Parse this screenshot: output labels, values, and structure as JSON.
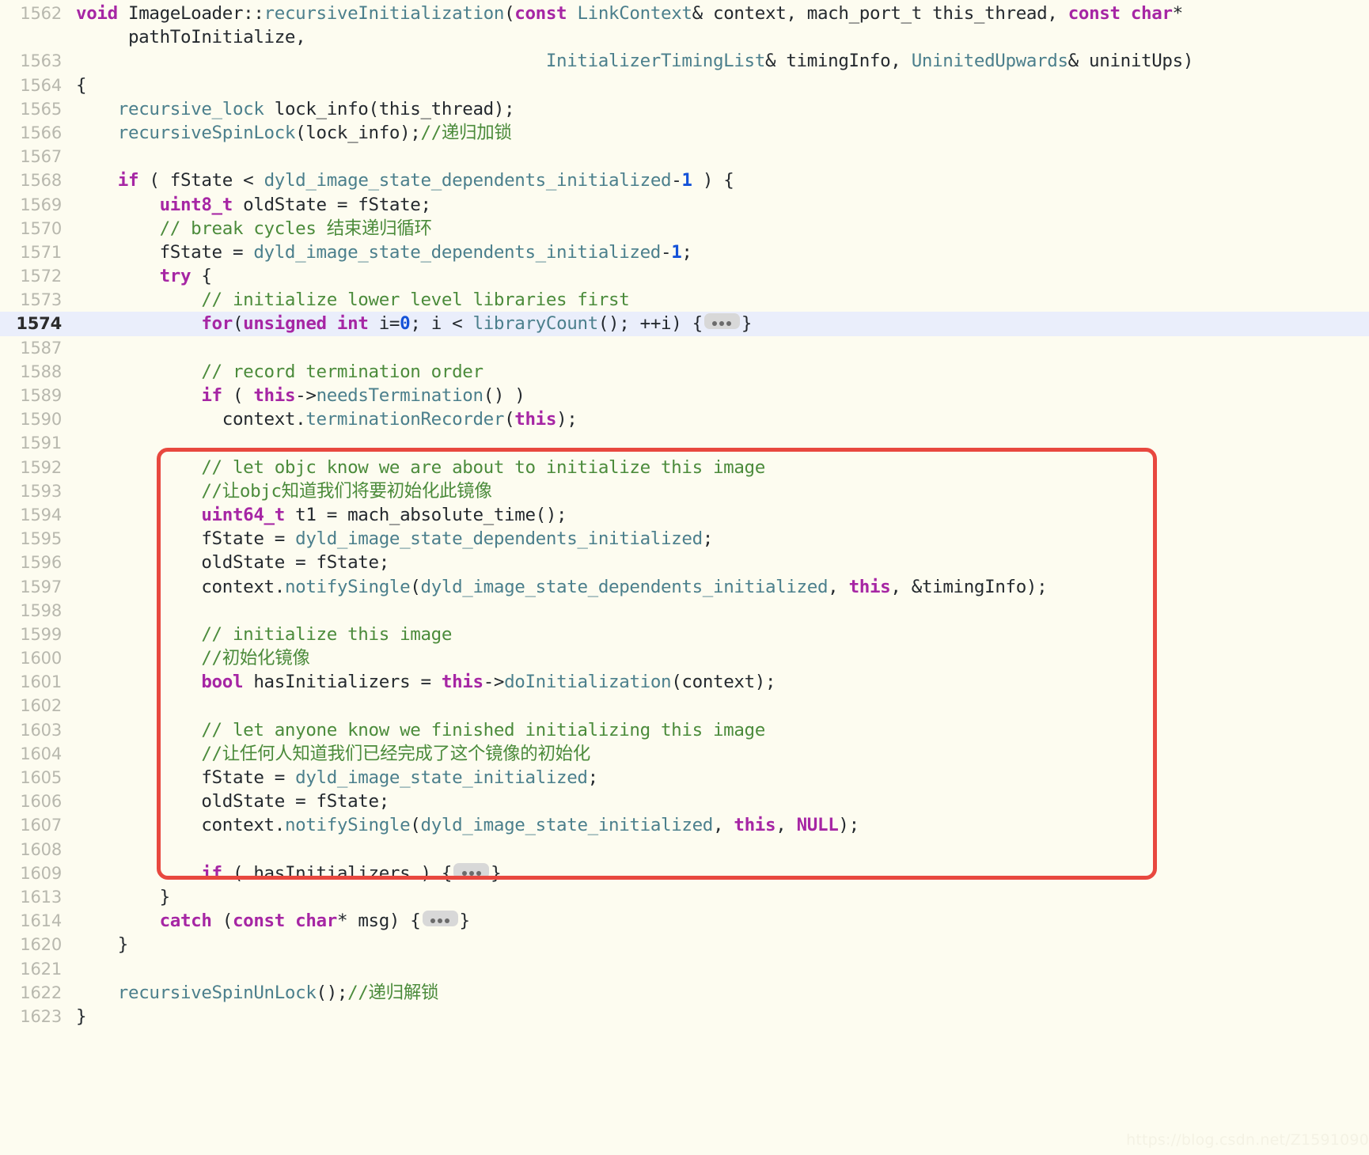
{
  "viewer": {
    "language": "C++",
    "background_color": "#fdfcf0",
    "highlight_color": "#eaeefb",
    "annotation_color": "#e8483f",
    "gutter_color": "#b8b8ae"
  },
  "watermark": {
    "text": "https://blog.csdn.net/Z1591090"
  },
  "collapse_button": {
    "label": "•••",
    "name": "expand-hidden-lines"
  },
  "annotation": {
    "type": "red-rounded-rectangle",
    "covers_lines": "1592-1607",
    "color": "#e8483f"
  },
  "lines": [
    {
      "num": "1562",
      "highlight": false,
      "tokens": [
        {
          "t": "kw",
          "s": "void"
        },
        {
          "t": "plain",
          "s": " ImageLoader::"
        },
        {
          "t": "typ",
          "s": "recursiveInitialization"
        },
        {
          "t": "plain",
          "s": "("
        },
        {
          "t": "kw",
          "s": "const"
        },
        {
          "t": "plain",
          "s": " "
        },
        {
          "t": "typ",
          "s": "LinkContext"
        },
        {
          "t": "plain",
          "s": "& context, mach_port_t this_thread, "
        },
        {
          "t": "kw",
          "s": "const char"
        },
        {
          "t": "plain",
          "s": "*"
        }
      ]
    },
    {
      "num": "",
      "highlight": false,
      "indent": 0,
      "tokens": [
        {
          "t": "plain",
          "s": "     pathToInitialize,"
        }
      ]
    },
    {
      "num": "1563",
      "highlight": false,
      "tokens": [
        {
          "t": "plain",
          "s": "                                             "
        },
        {
          "t": "typ",
          "s": "InitializerTimingList"
        },
        {
          "t": "plain",
          "s": "& timingInfo, "
        },
        {
          "t": "typ",
          "s": "UninitedUpwards"
        },
        {
          "t": "plain",
          "s": "& uninitUps)"
        }
      ]
    },
    {
      "num": "1564",
      "highlight": false,
      "tokens": [
        {
          "t": "plain",
          "s": "{"
        }
      ]
    },
    {
      "num": "1565",
      "highlight": false,
      "tokens": [
        {
          "t": "plain",
          "s": "    "
        },
        {
          "t": "typ",
          "s": "recursive_lock"
        },
        {
          "t": "plain",
          "s": " lock_info(this_thread);"
        }
      ]
    },
    {
      "num": "1566",
      "highlight": false,
      "tokens": [
        {
          "t": "plain",
          "s": "    "
        },
        {
          "t": "typ",
          "s": "recursiveSpinLock"
        },
        {
          "t": "plain",
          "s": "(lock_info);"
        },
        {
          "t": "cmt",
          "s": "//递归加锁"
        }
      ]
    },
    {
      "num": "1567",
      "highlight": false,
      "tokens": []
    },
    {
      "num": "1568",
      "highlight": false,
      "tokens": [
        {
          "t": "plain",
          "s": "    "
        },
        {
          "t": "kw",
          "s": "if"
        },
        {
          "t": "plain",
          "s": " ( fState < "
        },
        {
          "t": "typ",
          "s": "dyld_image_state_dependents_initialized"
        },
        {
          "t": "plain",
          "s": "-"
        },
        {
          "t": "num",
          "s": "1"
        },
        {
          "t": "plain",
          "s": " ) {"
        }
      ]
    },
    {
      "num": "1569",
      "highlight": false,
      "tokens": [
        {
          "t": "plain",
          "s": "        "
        },
        {
          "t": "kw",
          "s": "uint8_t"
        },
        {
          "t": "plain",
          "s": " oldState = fState;"
        }
      ]
    },
    {
      "num": "1570",
      "highlight": false,
      "tokens": [
        {
          "t": "plain",
          "s": "        "
        },
        {
          "t": "cmt",
          "s": "// break cycles 结束递归循环"
        }
      ]
    },
    {
      "num": "1571",
      "highlight": false,
      "tokens": [
        {
          "t": "plain",
          "s": "        fState = "
        },
        {
          "t": "typ",
          "s": "dyld_image_state_dependents_initialized"
        },
        {
          "t": "plain",
          "s": "-"
        },
        {
          "t": "num",
          "s": "1"
        },
        {
          "t": "plain",
          "s": ";"
        }
      ]
    },
    {
      "num": "1572",
      "highlight": false,
      "tokens": [
        {
          "t": "plain",
          "s": "        "
        },
        {
          "t": "kw",
          "s": "try"
        },
        {
          "t": "plain",
          "s": " {"
        }
      ]
    },
    {
      "num": "1573",
      "highlight": false,
      "tokens": [
        {
          "t": "plain",
          "s": "            "
        },
        {
          "t": "cmt",
          "s": "// initialize lower level libraries first"
        }
      ]
    },
    {
      "num": "1574",
      "highlight": true,
      "tokens": [
        {
          "t": "plain",
          "s": "            "
        },
        {
          "t": "kw",
          "s": "for"
        },
        {
          "t": "plain",
          "s": "("
        },
        {
          "t": "kw",
          "s": "unsigned int"
        },
        {
          "t": "plain",
          "s": " i="
        },
        {
          "t": "num",
          "s": "0"
        },
        {
          "t": "plain",
          "s": "; i < "
        },
        {
          "t": "fn",
          "s": "libraryCount"
        },
        {
          "t": "plain",
          "s": "(); ++i) {"
        },
        {
          "t": "dots",
          "s": "•••"
        },
        {
          "t": "plain",
          "s": "}"
        }
      ]
    },
    {
      "num": "1587",
      "highlight": false,
      "tokens": []
    },
    {
      "num": "1588",
      "highlight": false,
      "tokens": [
        {
          "t": "plain",
          "s": "            "
        },
        {
          "t": "cmt",
          "s": "// record termination order"
        }
      ]
    },
    {
      "num": "1589",
      "highlight": false,
      "tokens": [
        {
          "t": "plain",
          "s": "            "
        },
        {
          "t": "kw",
          "s": "if"
        },
        {
          "t": "plain",
          "s": " ( "
        },
        {
          "t": "kw",
          "s": "this"
        },
        {
          "t": "plain",
          "s": "->"
        },
        {
          "t": "fn",
          "s": "needsTermination"
        },
        {
          "t": "plain",
          "s": "() )"
        }
      ]
    },
    {
      "num": "1590",
      "highlight": false,
      "tokens": [
        {
          "t": "plain",
          "s": "              context."
        },
        {
          "t": "fn",
          "s": "terminationRecorder"
        },
        {
          "t": "plain",
          "s": "("
        },
        {
          "t": "kw",
          "s": "this"
        },
        {
          "t": "plain",
          "s": ");"
        }
      ]
    },
    {
      "num": "1591",
      "highlight": false,
      "tokens": []
    },
    {
      "num": "1592",
      "highlight": false,
      "tokens": [
        {
          "t": "plain",
          "s": "            "
        },
        {
          "t": "cmt",
          "s": "// let objc know we are about to initialize this image"
        }
      ]
    },
    {
      "num": "1593",
      "highlight": false,
      "tokens": [
        {
          "t": "plain",
          "s": "            "
        },
        {
          "t": "cmt",
          "s": "//让objc知道我们将要初始化此镜像"
        }
      ]
    },
    {
      "num": "1594",
      "highlight": false,
      "tokens": [
        {
          "t": "plain",
          "s": "            "
        },
        {
          "t": "kw",
          "s": "uint64_t"
        },
        {
          "t": "plain",
          "s": " t1 = mach_absolute_time();"
        }
      ]
    },
    {
      "num": "1595",
      "highlight": false,
      "tokens": [
        {
          "t": "plain",
          "s": "            fState = "
        },
        {
          "t": "typ",
          "s": "dyld_image_state_dependents_initialized"
        },
        {
          "t": "plain",
          "s": ";"
        }
      ]
    },
    {
      "num": "1596",
      "highlight": false,
      "tokens": [
        {
          "t": "plain",
          "s": "            oldState = fState;"
        }
      ]
    },
    {
      "num": "1597",
      "highlight": false,
      "tokens": [
        {
          "t": "plain",
          "s": "            context."
        },
        {
          "t": "fn",
          "s": "notifySingle"
        },
        {
          "t": "plain",
          "s": "("
        },
        {
          "t": "typ",
          "s": "dyld_image_state_dependents_initialized"
        },
        {
          "t": "plain",
          "s": ", "
        },
        {
          "t": "kw",
          "s": "this"
        },
        {
          "t": "plain",
          "s": ", &timingInfo);"
        }
      ]
    },
    {
      "num": "1598",
      "highlight": false,
      "tokens": []
    },
    {
      "num": "1599",
      "highlight": false,
      "tokens": [
        {
          "t": "plain",
          "s": "            "
        },
        {
          "t": "cmt",
          "s": "// initialize this image"
        }
      ]
    },
    {
      "num": "1600",
      "highlight": false,
      "tokens": [
        {
          "t": "plain",
          "s": "            "
        },
        {
          "t": "cmt",
          "s": "//初始化镜像"
        }
      ]
    },
    {
      "num": "1601",
      "highlight": false,
      "tokens": [
        {
          "t": "plain",
          "s": "            "
        },
        {
          "t": "kw",
          "s": "bool"
        },
        {
          "t": "plain",
          "s": " hasInitializers = "
        },
        {
          "t": "kw",
          "s": "this"
        },
        {
          "t": "plain",
          "s": "->"
        },
        {
          "t": "fn",
          "s": "doInitialization"
        },
        {
          "t": "plain",
          "s": "(context);"
        }
      ]
    },
    {
      "num": "1602",
      "highlight": false,
      "tokens": []
    },
    {
      "num": "1603",
      "highlight": false,
      "tokens": [
        {
          "t": "plain",
          "s": "            "
        },
        {
          "t": "cmt",
          "s": "// let anyone know we finished initializing this image"
        }
      ]
    },
    {
      "num": "1604",
      "highlight": false,
      "tokens": [
        {
          "t": "plain",
          "s": "            "
        },
        {
          "t": "cmt",
          "s": "//让任何人知道我们已经完成了这个镜像的初始化"
        }
      ]
    },
    {
      "num": "1605",
      "highlight": false,
      "tokens": [
        {
          "t": "plain",
          "s": "            fState = "
        },
        {
          "t": "typ",
          "s": "dyld_image_state_initialized"
        },
        {
          "t": "plain",
          "s": ";"
        }
      ]
    },
    {
      "num": "1606",
      "highlight": false,
      "tokens": [
        {
          "t": "plain",
          "s": "            oldState = fState;"
        }
      ]
    },
    {
      "num": "1607",
      "highlight": false,
      "tokens": [
        {
          "t": "plain",
          "s": "            context."
        },
        {
          "t": "fn",
          "s": "notifySingle"
        },
        {
          "t": "plain",
          "s": "("
        },
        {
          "t": "typ",
          "s": "dyld_image_state_initialized"
        },
        {
          "t": "plain",
          "s": ", "
        },
        {
          "t": "kw",
          "s": "this"
        },
        {
          "t": "plain",
          "s": ", "
        },
        {
          "t": "kw",
          "s": "NULL"
        },
        {
          "t": "plain",
          "s": ");"
        }
      ]
    },
    {
      "num": "1608",
      "highlight": false,
      "tokens": []
    },
    {
      "num": "1609",
      "highlight": false,
      "tokens": [
        {
          "t": "plain",
          "s": "            "
        },
        {
          "t": "kw",
          "s": "if"
        },
        {
          "t": "plain",
          "s": " ( hasInitializers ) {"
        },
        {
          "t": "dots",
          "s": "•••"
        },
        {
          "t": "plain",
          "s": "}"
        }
      ]
    },
    {
      "num": "1613",
      "highlight": false,
      "tokens": [
        {
          "t": "plain",
          "s": "        }"
        }
      ]
    },
    {
      "num": "1614",
      "highlight": false,
      "tokens": [
        {
          "t": "plain",
          "s": "        "
        },
        {
          "t": "kw",
          "s": "catch"
        },
        {
          "t": "plain",
          "s": " ("
        },
        {
          "t": "kw",
          "s": "const char"
        },
        {
          "t": "plain",
          "s": "* msg) {"
        },
        {
          "t": "dots",
          "s": "•••"
        },
        {
          "t": "plain",
          "s": "}"
        }
      ]
    },
    {
      "num": "1620",
      "highlight": false,
      "tokens": [
        {
          "t": "plain",
          "s": "    }"
        }
      ]
    },
    {
      "num": "1621",
      "highlight": false,
      "tokens": []
    },
    {
      "num": "1622",
      "highlight": false,
      "tokens": [
        {
          "t": "plain",
          "s": "    "
        },
        {
          "t": "typ",
          "s": "recursiveSpinUnLock"
        },
        {
          "t": "plain",
          "s": "();"
        },
        {
          "t": "cmt",
          "s": "//递归解锁"
        }
      ]
    },
    {
      "num": "1623",
      "highlight": false,
      "tokens": [
        {
          "t": "plain",
          "s": "}"
        }
      ]
    }
  ]
}
